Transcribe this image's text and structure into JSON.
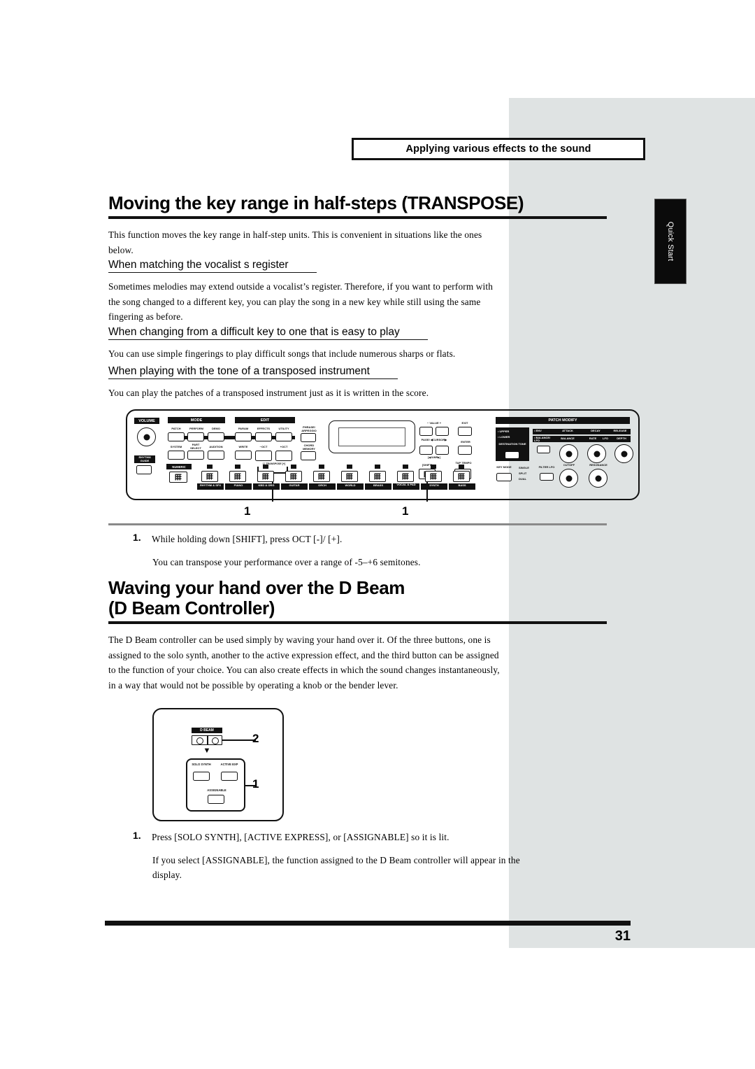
{
  "page": {
    "number": "31",
    "side_tab": "Quick Start",
    "banner": "Applying various effects to the sound"
  },
  "sections": [
    {
      "title": "Moving the key range in half-steps (TRANSPOSE)",
      "intro": "This function moves the key range in half-step units. This is convenient in situations like the ones below.",
      "subsections": [
        {
          "heading": "When matching the vocalist s register",
          "body": "Sometimes melodies may extend outside a vocalist’s register. Therefore, if you want to perform with the song changed to a different key, you can play the song in a new key while still using the same fingering as before."
        },
        {
          "heading": "When changing from a difficult key to one that is easy to play",
          "body": "You can use simple fingerings to play difficult songs that include numerous sharps or flats."
        },
        {
          "heading": "When playing with the tone of a transposed instrument",
          "body": "You can play the patches of a transposed instrument just as it is written in the score."
        }
      ],
      "steps": [
        {
          "num": "1.",
          "text": "While holding down [SHIFT], press OCT [-]/ [+].",
          "note": "You can transpose your performance over a range of -5–+6 semitones."
        }
      ]
    },
    {
      "title_line1": "Waving your hand over the D Beam",
      "title_line2": "(D Beam Controller)",
      "intro": "The D Beam controller can be used simply by waving your hand over it. Of the three buttons, one is assigned to the solo synth, another to the active expression effect, and the third button can be assigned to the function of your choice. You can also create effects in which the sound changes instantaneously, in a way that would not be possible by operating a knob or the bender lever.",
      "steps": [
        {
          "num": "1.",
          "text": "Press [SOLO SYNTH], [ACTIVE EXPRESS], or [ASSIGNABLE] so it is lit.",
          "note": "If you select [ASSIGNABLE], the function assigned to the D Beam controller will appear in the display."
        }
      ]
    }
  ],
  "keyboard_panel": {
    "volume_label": "VOLUME",
    "mode_label": "MODE",
    "edit_label": "EDIT",
    "patch_modify_label": "PATCH MODIFY",
    "mode_row1": [
      "PATCH",
      "PERFORM",
      "DEMO"
    ],
    "mode_row2": [
      "SYSTEM",
      "PART SELECT",
      "AUDITION"
    ],
    "edit_row1": [
      "PARAM",
      "EFFECTS",
      "UTILITY"
    ],
    "edit_row2": [
      "WRITE",
      "−OCT",
      "+OCT"
    ],
    "transpose_label": "[-] TRANSPOSE [+]",
    "phrase_arpeggio": "PHRASE/ ARPEGGIO",
    "chord_memory": "CHORD MEMORY",
    "rhythm_guide": "RHYTHM GUIDE",
    "numeric": "NUMERIC",
    "value_label": "− VALUE +",
    "exit_label": "EXIT",
    "page_cursor_label": "PAGE/ ◀CURSOR▶",
    "jump_label": "[◀JUMP▶]",
    "enter_label": "ENTER",
    "shift_label": "[SHIFT]",
    "tap_tempo_label": "TAP TEMPO",
    "categories": [
      "RHYTHM & SFX",
      "PIANO",
      "KBD & ORG",
      "GUITAR",
      "ORCH",
      "WORLD",
      "BRASS",
      "VOCAL & PAD",
      "SYNTH",
      "BASS"
    ],
    "category_numbers": [
      "0",
      "1",
      "2",
      "3",
      "4",
      "5",
      "6",
      "7",
      "8",
      "9"
    ],
    "destination_rows": [
      "• UPPER",
      "• LOWER"
    ],
    "destination_tone": "DESTINATION TONE",
    "env_label": "• ENV",
    "balance_lfo_label": "• BALANCE/ LFO",
    "knob_row1_top": [
      "ATTACK",
      "DECAY",
      "RELEASE"
    ],
    "knob_row1_bot": [
      "BALANCE",
      "RATE",
      "LFO",
      "DEPTH"
    ],
    "key_mode_label": "KEY MODE",
    "key_modes": [
      "SINGLE",
      "SPLIT",
      "DUAL"
    ],
    "filter_lfo_label": "FILTER LFO",
    "knob_row2": [
      "CUTOFF",
      "RESONANCE"
    ],
    "callouts": [
      "1",
      "1"
    ]
  },
  "dbeam_panel": {
    "title": "D BEAM",
    "buttons": [
      "SOLO SYNTH",
      "ACTIVE EXP",
      "ASSIGNABLE"
    ],
    "callouts": [
      "2",
      "1"
    ]
  }
}
